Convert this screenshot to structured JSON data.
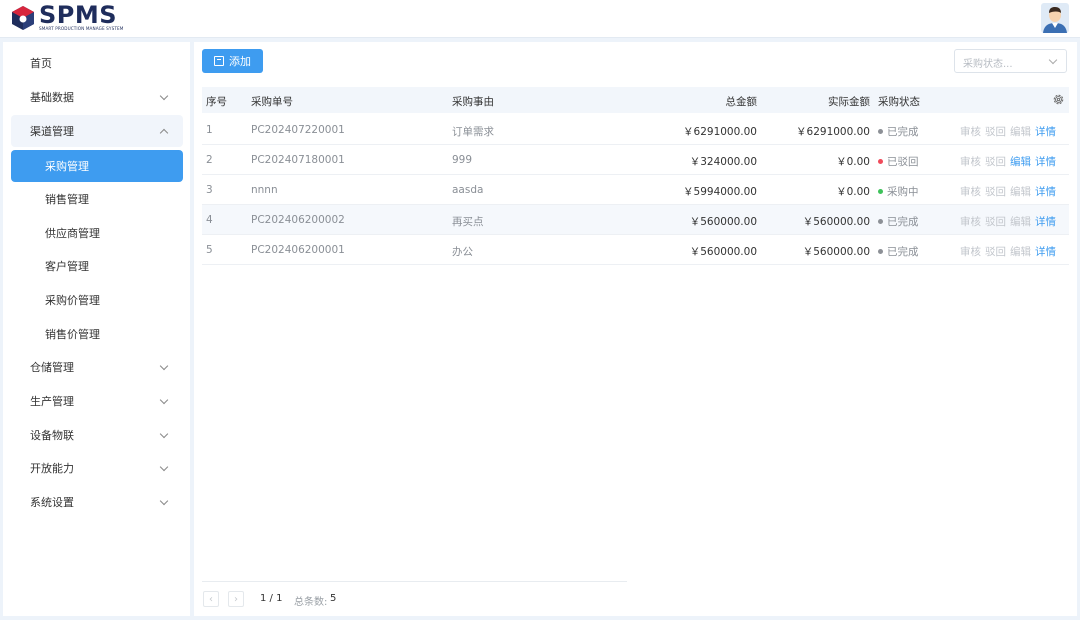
{
  "header": {
    "logo_title": "SPMS",
    "logo_subtitle": "SMART PRODUCTION MANAGE SYSTEM",
    "avatar_icon": "user-avatar"
  },
  "sidebar": {
    "items": [
      {
        "label": "首页"
      },
      {
        "label": "基础数据"
      },
      {
        "label": "渠道管理"
      },
      {
        "label": "采购管理"
      },
      {
        "label": "销售管理"
      },
      {
        "label": "供应商管理"
      },
      {
        "label": "客户管理"
      },
      {
        "label": "采购价管理"
      },
      {
        "label": "销售价管理"
      },
      {
        "label": "仓储管理"
      },
      {
        "label": "生产管理"
      },
      {
        "label": "设备物联"
      },
      {
        "label": "开放能力"
      },
      {
        "label": "系统设置"
      }
    ]
  },
  "toolbar": {
    "add_label": "添加",
    "status_placeholder": "采购状态..."
  },
  "table": {
    "columns": {
      "index": "序号",
      "order_no": "采购单号",
      "reason": "采购事由",
      "total": "总金额",
      "actual": "实际金额",
      "status": "采购状态"
    },
    "rows": [
      {
        "index": "1",
        "order_no": "PC202407220001",
        "reason": "订单需求",
        "total": "￥6291000.00",
        "actual": "￥6291000.00",
        "status": "已完成",
        "status_color": "#8c9096"
      },
      {
        "index": "2",
        "order_no": "PC202407180001",
        "reason": "999",
        "total": "￥324000.00",
        "actual": "￥0.00",
        "status": "已驳回",
        "status_color": "#f04a5a"
      },
      {
        "index": "3",
        "order_no": "nnnn",
        "reason": "aasda",
        "total": "￥5994000.00",
        "actual": "￥0.00",
        "status": "采购中",
        "status_color": "#3ec25a"
      },
      {
        "index": "4",
        "order_no": "PC202406200002",
        "reason": "再买点",
        "total": "￥560000.00",
        "actual": "￥560000.00",
        "status": "已完成",
        "status_color": "#8c9096"
      },
      {
        "index": "5",
        "order_no": "PC202406200001",
        "reason": "办公",
        "total": "￥560000.00",
        "actual": "￥560000.00",
        "status": "已完成",
        "status_color": "#8c9096"
      }
    ],
    "actions": {
      "audit": "审核",
      "reject": "驳回",
      "edit": "编辑",
      "detail": "详情"
    }
  },
  "pagination": {
    "page": "1 / 1",
    "total_label": "总条数:",
    "total": "5"
  },
  "colors": {
    "accent": "#3e9cf0",
    "brand": "#1f2d5c"
  }
}
